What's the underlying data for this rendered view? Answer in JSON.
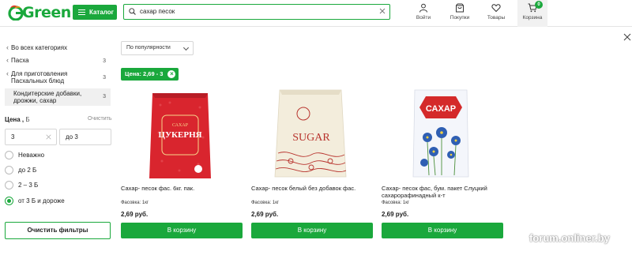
{
  "header": {
    "logo_text": "Green",
    "catalog_label": "Каталог",
    "search": {
      "value": "сахар песок",
      "placeholder": ""
    },
    "nav": [
      {
        "label": "Войти",
        "icon": "user-icon"
      },
      {
        "label": "Покупки",
        "icon": "bag-icon"
      },
      {
        "label": "Товары",
        "icon": "heart-icon"
      }
    ],
    "cart": {
      "label": "Корзина",
      "count": "0",
      "icon": "cart-icon"
    }
  },
  "sidebar": {
    "back_label": "Во всех категориях",
    "categories": [
      {
        "label": "Пасха",
        "count": "3",
        "active": false
      },
      {
        "label": "Для приготовления Пасхальных блюд",
        "count": "3",
        "active": false
      },
      {
        "label": "Кондитерские добавки, дрожжи, сахар",
        "count": "3",
        "active": true
      }
    ],
    "price": {
      "title": "Цена ,",
      "currency": "Б",
      "reset_label": "Очистить",
      "from": "3",
      "to": "до 3"
    },
    "price_options": [
      {
        "label": "Неважно",
        "selected": false
      },
      {
        "label": "до 2 Б",
        "selected": false
      },
      {
        "label": "2 – 3 Б",
        "selected": false
      },
      {
        "label": "от 3 Б и дороже",
        "selected": true
      }
    ],
    "clear_filters_label": "Очистить фильтры"
  },
  "main": {
    "sort_label": "По популярности",
    "active_filter_chip": "Цена: 2,69 - 3",
    "products": [
      {
        "name": "Сахар- песок фас. 6кг. пак.",
        "pack": "Фасовка: 1кг",
        "price": "2,69 руб.",
        "buy_label": "В корзину",
        "package_text_top": "САХАР",
        "package_text_main": "ЦУКЕРНЯ",
        "package_color": "#d9252e"
      },
      {
        "name": "Сахар- песок белый без добавок фас.",
        "pack": "Фасовка: 1кг",
        "price": "2,69 руб.",
        "buy_label": "В корзину",
        "package_text_main": "SUGAR",
        "package_color": "#f3eddc"
      },
      {
        "name": "Сахар- песок фас, бум. пакет Слуцкий сахарорафинадный к-т",
        "pack": "Фасовка: 1кг",
        "price": "2,69 руб.",
        "buy_label": "В корзину",
        "package_text_main": "САХАР",
        "package_color": "#f4f6fb"
      }
    ]
  },
  "watermark": "forum.onliner.by",
  "colors": {
    "accent": "#1aa83c",
    "text": "#222222",
    "muted": "#888888"
  }
}
